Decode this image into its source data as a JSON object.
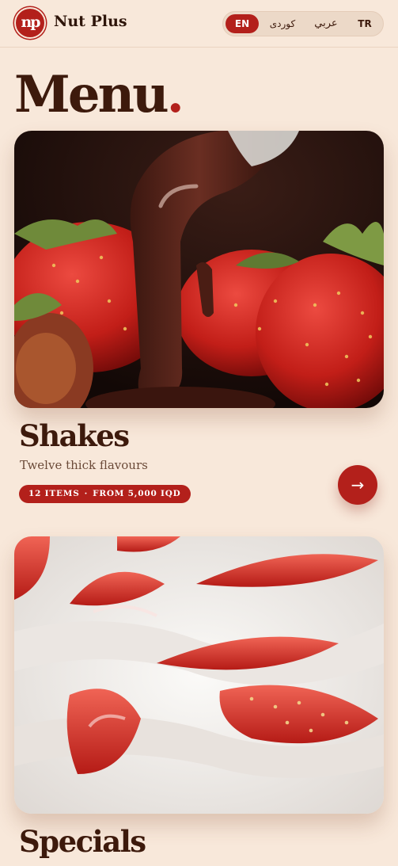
{
  "header": {
    "logo_text": "np",
    "brand": "Nut Plus",
    "languages": [
      {
        "code": "EN",
        "active": true
      },
      {
        "code": "کوردی",
        "active": false
      },
      {
        "code": "عربي",
        "active": false
      },
      {
        "code": "TR",
        "active": false
      }
    ]
  },
  "page": {
    "title": "Menu",
    "title_dot": "."
  },
  "cards": [
    {
      "name": "Shakes",
      "description": "Twelve thick flavours",
      "items": "12 ITEMS",
      "separator": "·",
      "price": "FROM 5,000 IQD",
      "image": "chocolate-strawberries-photo"
    },
    {
      "name": "Specials",
      "image": "strawberries-cream-photo"
    }
  ],
  "icons": {
    "arrow": "arrow-right-icon"
  },
  "colors": {
    "background": "#f8e8da",
    "accent": "#b3201b",
    "text": "#3d1a0c"
  }
}
